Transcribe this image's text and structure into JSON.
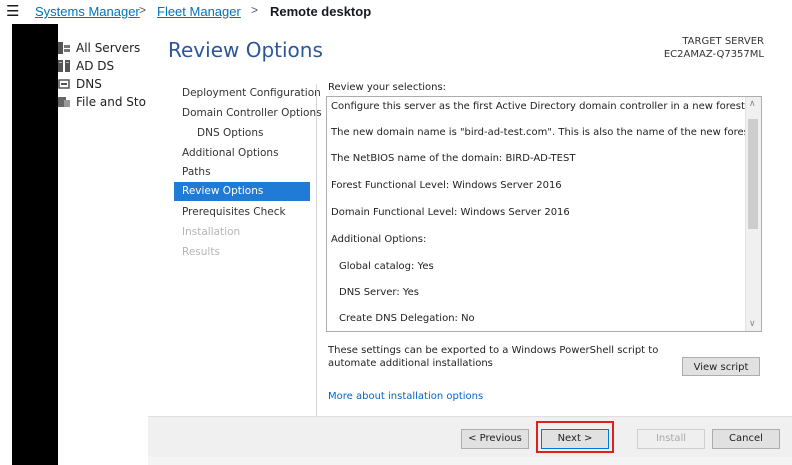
{
  "breadcrumb": {
    "menu_icon": "hamburger-menu-icon",
    "items": [
      {
        "label": "Systems Manager",
        "link": true
      },
      {
        "label": "Fleet Manager",
        "link": true
      },
      {
        "label": "Remote desktop",
        "link": false
      }
    ],
    "separator": ">"
  },
  "server_manager_nav": [
    {
      "icon": "all-servers-icon",
      "label": "All Servers"
    },
    {
      "icon": "ad-ds-icon",
      "label": "AD DS"
    },
    {
      "icon": "dns-icon",
      "label": "DNS"
    },
    {
      "icon": "file-storage-icon",
      "label": "File and Sto"
    }
  ],
  "wizard": {
    "title": "Review Options",
    "target_label": "TARGET SERVER",
    "target_name": "EC2AMAZ-Q7357ML",
    "steps": [
      {
        "label": "Deployment Configuration",
        "state": "normal"
      },
      {
        "label": "Domain Controller Options",
        "state": "normal"
      },
      {
        "label": "DNS Options",
        "state": "sub"
      },
      {
        "label": "Additional Options",
        "state": "normal"
      },
      {
        "label": "Paths",
        "state": "normal"
      },
      {
        "label": "Review Options",
        "state": "active"
      },
      {
        "label": "Prerequisites Check",
        "state": "normal"
      },
      {
        "label": "Installation",
        "state": "disabled"
      },
      {
        "label": "Results",
        "state": "disabled"
      }
    ],
    "review_label": "Review your selections:",
    "review_lines": [
      {
        "text": "Configure this server as the first Active Directory domain controller in a new forest.",
        "indent": false
      },
      {
        "text": "The new domain name is \"bird-ad-test.com\". This is also the name of the new forest.",
        "indent": false
      },
      {
        "text": "The NetBIOS name of the domain: BIRD-AD-TEST",
        "indent": false
      },
      {
        "text": "Forest Functional Level: Windows Server 2016",
        "indent": false
      },
      {
        "text": "Domain Functional Level: Windows Server 2016",
        "indent": false
      },
      {
        "text": "Additional Options:",
        "indent": false
      },
      {
        "text": "Global catalog: Yes",
        "indent": true
      },
      {
        "text": "DNS Server: Yes",
        "indent": true
      },
      {
        "text": "Create DNS Delegation: No",
        "indent": true
      }
    ],
    "export_text": "These settings can be exported to a Windows PowerShell script to automate additional installations",
    "view_script_label": "View script",
    "more_link": "More about installation options",
    "buttons": {
      "previous": "< Previous",
      "next": "Next >",
      "install": "Install",
      "cancel": "Cancel"
    }
  },
  "colors": {
    "link_blue": "#0073bb",
    "wizard_title": "#2b579a",
    "active_step": "#1f7bd6",
    "highlight_red": "#e02020"
  }
}
